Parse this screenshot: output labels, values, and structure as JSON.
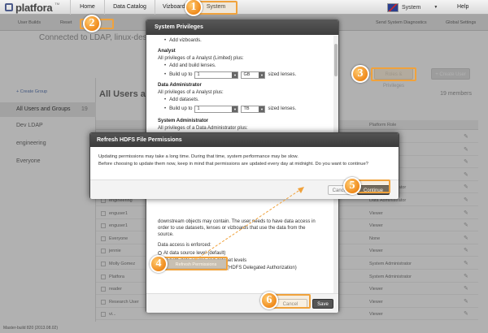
{
  "app": {
    "logo_text": "platfora",
    "logo_tm": "TM"
  },
  "nav": {
    "tabs": [
      "Home",
      "Data Catalog",
      "Vizboards",
      "System"
    ],
    "active_tab": "System",
    "user_name": "System",
    "help": "Help"
  },
  "subbar": {
    "items": [
      "User Builds",
      "Reset",
      "Send System Diagnostics",
      "Global Settings"
    ],
    "connected": "Connected to LDAP, linux-desktop..."
  },
  "left_panel": {
    "create_group": "+ Create Group",
    "groups": [
      {
        "label": "All Users and Groups",
        "count": "19"
      },
      {
        "label": "Dev LDAP",
        "count": ""
      },
      {
        "label": "engineering",
        "count": ""
      },
      {
        "label": "Everyone",
        "count": ""
      }
    ]
  },
  "right_panel": {
    "title": "All Users and Groups",
    "members": "19 members",
    "roles_button": "Roles & Privileges",
    "create_user": "+ Create User",
    "column_role": "Platform Role",
    "rows": [
      {
        "name": "",
        "role": "Administrator"
      },
      {
        "name": "",
        "role": "Administrator"
      },
      {
        "name": "",
        "role": "Administrator"
      },
      {
        "name": "",
        "role": "Administrator"
      },
      {
        "name": "",
        "role": "Data Administrator"
      },
      {
        "name": "engineering",
        "role": "Data Administrator"
      },
      {
        "name": "enguser1",
        "role": "Viewer"
      },
      {
        "name": "enguser1",
        "role": "Viewer"
      },
      {
        "name": "Everyone",
        "role": "None"
      },
      {
        "name": "jennie",
        "role": "Viewer"
      },
      {
        "name": "Molly Gomez",
        "role": "System Administrator"
      },
      {
        "name": "Platfora",
        "role": "System Administrator"
      },
      {
        "name": "reader",
        "role": "Viewer"
      },
      {
        "name": "Research User",
        "role": "Viewer"
      },
      {
        "name": "vi...",
        "role": "Viewer"
      }
    ]
  },
  "system_privileges": {
    "title": "System Privileges",
    "top_text": "Add vizboards.",
    "analyst_title": "Analyst",
    "analyst_desc": "All privileges of a Analyst (Limited) plus:",
    "analyst_bullet1": "Add and build lenses.",
    "build_up_to": "Build up to",
    "analyst_qty": "1",
    "analyst_unit": "GB",
    "sized_lenses": "sized lenses.",
    "data_admin_title": "Data Administrator",
    "data_admin_desc": "All privileges of a Analyst plus:",
    "data_admin_bullet1": "Add datasets.",
    "data_admin_qty": "1",
    "data_admin_unit": "TB",
    "sys_admin_title": "System Administrator",
    "sys_admin_desc": "All privileges of a Data Administrator plus:",
    "access_text1": "downstream objects may contain. The user needs to have data access in",
    "access_text2": "order to use datasets, lenses or vizboards that use the data from the",
    "access_text3": "source.",
    "enforced_label": "Data access is enforced:",
    "option1": "At data source level (default)",
    "option2": "At both data source and dataset levels",
    "option3": "Using HDFS file permissions (HDFS Delegated Authorization)",
    "refresh_button": "Refresh Permissions",
    "cancel": "Cancel",
    "save": "Save"
  },
  "refresh_dialog": {
    "title": "Refresh HDFS File Permissions",
    "line1": "Updating permissions may take a long time. During that time, system performance may be slow.",
    "line2": "Before choosing to update them now, keep in mind that permissions are updated every day at midnight. Do you want to continue?",
    "cancel": "Cancel",
    "continue": "Continue"
  },
  "callouts": [
    "1",
    "2",
    "3",
    "4",
    "5",
    "6"
  ],
  "footer": "Master-build 820 (2013.08.02)",
  "colors": {
    "callout": "#ef8a1c",
    "dialog_header": "#474747"
  }
}
